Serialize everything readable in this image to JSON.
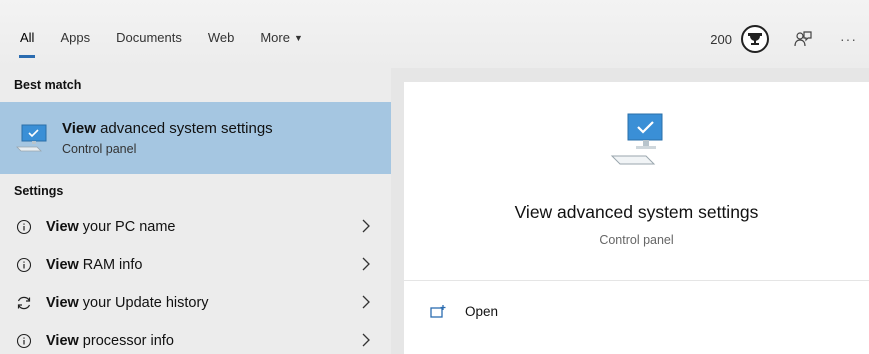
{
  "tabs": [
    {
      "label": "All",
      "active": true
    },
    {
      "label": "Apps"
    },
    {
      "label": "Documents"
    },
    {
      "label": "Web"
    },
    {
      "label": "More"
    }
  ],
  "toolbar": {
    "points": "200",
    "icons": [
      "rewards-trophy-icon",
      "feedback-icon",
      "more-options-icon"
    ],
    "more_glyph": "···"
  },
  "best_match": {
    "header": "Best match",
    "title_bold": "View",
    "title_rest": " advanced system settings",
    "subtitle": "Control panel",
    "icon": "monitor-check-icon"
  },
  "settings": {
    "header": "Settings",
    "items": [
      {
        "bold": "View",
        "rest": " your PC name",
        "icon": "info-icon"
      },
      {
        "bold": "View",
        "rest": " RAM info",
        "icon": "info-icon"
      },
      {
        "bold": "View",
        "rest": " your Update history",
        "icon": "refresh-icon"
      },
      {
        "bold": "View",
        "rest": " processor info",
        "icon": "info-icon"
      }
    ]
  },
  "detail": {
    "title": "View advanced system settings",
    "subtitle": "Control panel",
    "open_label": "Open"
  },
  "colors": {
    "selection": "#a5c6e1",
    "accent": "#2b6cb0",
    "background": "#ececec"
  }
}
